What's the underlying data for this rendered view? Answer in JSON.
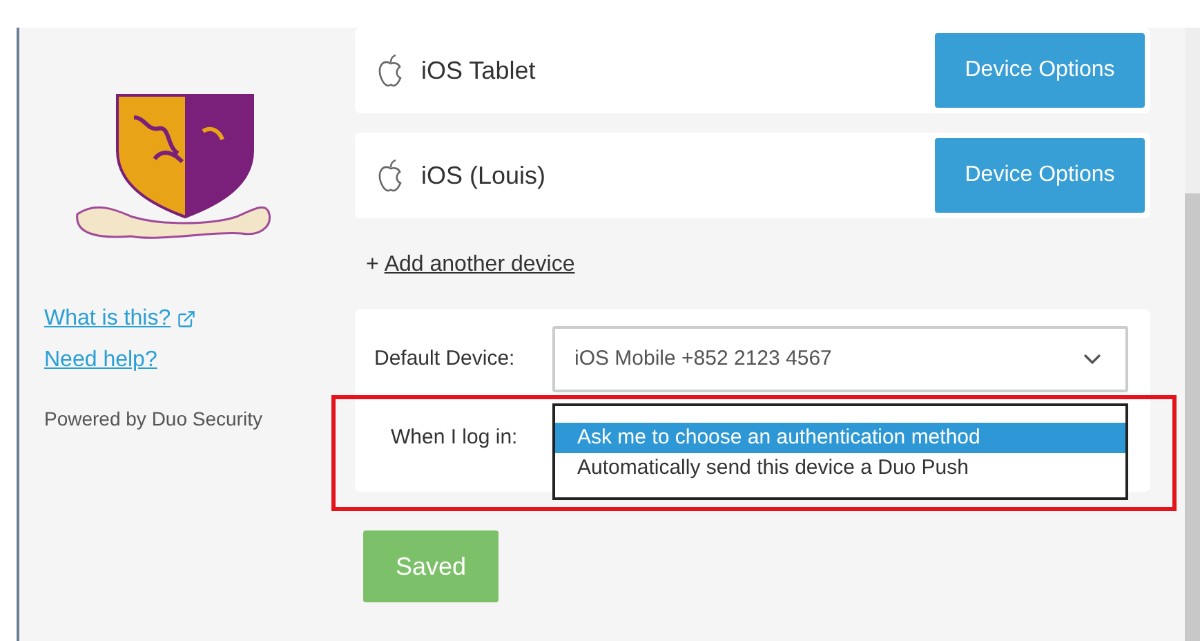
{
  "sidebar": {
    "links": [
      {
        "label": "What is this?",
        "external": true
      },
      {
        "label": "Need help?",
        "external": false
      }
    ],
    "powered_by": "Powered by Duo Security"
  },
  "devices": [
    {
      "name": "iOS Tablet",
      "button": "Device Options"
    },
    {
      "name": "iOS (Louis)",
      "button": "Device Options"
    }
  ],
  "add_device": {
    "plus": "+",
    "label": "Add another device"
  },
  "settings": {
    "default_device": {
      "label": "Default Device:",
      "value": "iOS Mobile +852 2123 4567"
    },
    "login": {
      "label": "When I log in:",
      "highlighted": true,
      "options": [
        {
          "label": "Ask me to choose an authentication method",
          "selected": true
        },
        {
          "label": "Automatically send this device a Duo Push",
          "selected": false
        }
      ]
    }
  },
  "save_button": "Saved"
}
